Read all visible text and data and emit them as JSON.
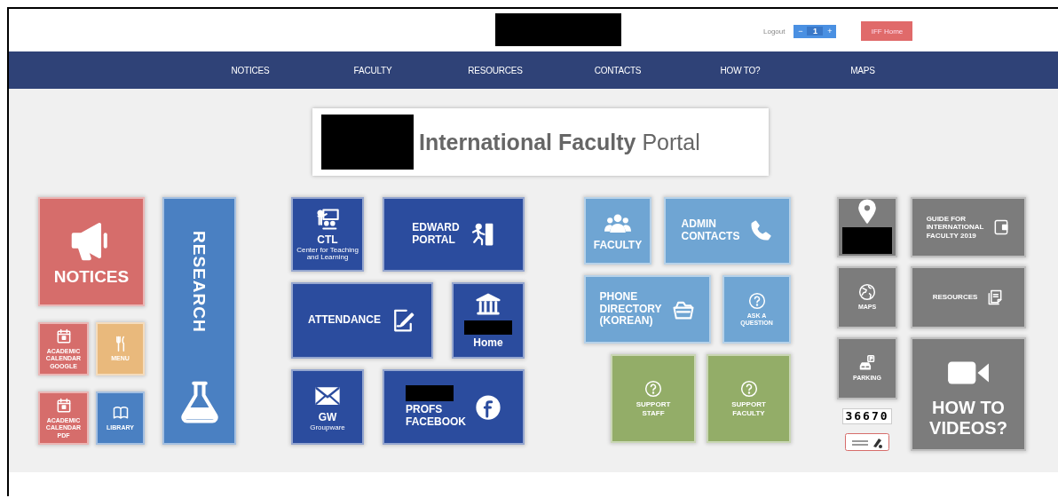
{
  "header": {
    "logo_redacted": true,
    "logout": "Logout",
    "stepper": {
      "minus": "−",
      "value": "1",
      "plus": "+"
    },
    "home_button": "IFF Home"
  },
  "nav": [
    "NOTICES",
    "FACULTY",
    "RESOURCES",
    "CONTACTS",
    "HOW TO?",
    "MAPS"
  ],
  "title": {
    "logo_redacted": true,
    "text": "**International Faculty** Portal"
  },
  "groups": [
    [
      {
        "label": "NOTICES",
        "kind": "megaphone",
        "color": "#d66d6b"
      },
      {
        "label": "RESEARCH",
        "kind": "flask",
        "color": "#4a80c2"
      },
      {
        "label": "ACADEMIC CALENDAR GOOGLE",
        "kind": "calendar",
        "color": "#d66d6b"
      },
      {
        "label": "MENU",
        "kind": "cutlery",
        "color": "#e9b97c"
      },
      {
        "label": "ACADEMIC CALENDAR PDF",
        "kind": "calendar",
        "color": "#d66d6b"
      },
      {
        "label": "LIBRARY",
        "kind": "book",
        "color": "#4a80c2"
      }
    ],
    [
      {
        "label": "CTL",
        "sublabel": "Center for Teaching and Learning",
        "kind": "teacher",
        "color": "#2b4c9e"
      },
      {
        "label": "EDWARD\nPORTAL",
        "kind": "exit",
        "color": "#2b4c9e"
      },
      {
        "label": "ATTENDANCE",
        "kind": "form",
        "color": "#2b4c9e"
      },
      {
        "label": "Home",
        "kind": "bank",
        "color": "#2b4c9e",
        "redacted": true
      },
      {
        "label": "GW",
        "sublabel": "Groupware",
        "kind": "envelope",
        "color": "#2b4c9e"
      },
      {
        "label": "PROFS\nFACEBOOK",
        "kind": "facebook",
        "color": "#2b4c9e",
        "redacted": true
      }
    ],
    [
      {
        "label": "FACULTY",
        "kind": "people",
        "color": "#6fa5d3"
      },
      {
        "label": "ADMIN\nCONTACTS",
        "kind": "phone",
        "color": "#6fa5d3"
      },
      {
        "label": "PHONE\nDIRECTORY\n(KOREAN)",
        "kind": "basket",
        "color": "#6fa5d3"
      },
      {
        "label": "ASK A\nQUESTION",
        "kind": "question",
        "color": "#6fa5d3"
      },
      {
        "label": "SUPPORT\nSTAFF",
        "kind": "question",
        "color": "#93ad68"
      },
      {
        "label": "SUPPORT\nFACULTY",
        "kind": "question",
        "color": "#93ad68"
      }
    ],
    [
      {
        "kind": "pin",
        "color": "#7c7c7c",
        "redacted": true
      },
      {
        "label": "GUIDE FOR\nINTERNATIONAL\nFACULTY 2019",
        "kind": "document",
        "color": "#7c7c7c"
      },
      {
        "label": "MAPS",
        "kind": "globe",
        "color": "#7c7c7c"
      },
      {
        "label": "RESOURCES",
        "kind": "copies",
        "color": "#7c7c7c"
      },
      {
        "label": "PARKING",
        "kind": "parking",
        "color": "#7c7c7c"
      },
      {
        "label": "HOW TO\nVIDEOS?",
        "kind": "video",
        "color": "#7c7c7c"
      }
    ]
  ],
  "counter": "36670"
}
